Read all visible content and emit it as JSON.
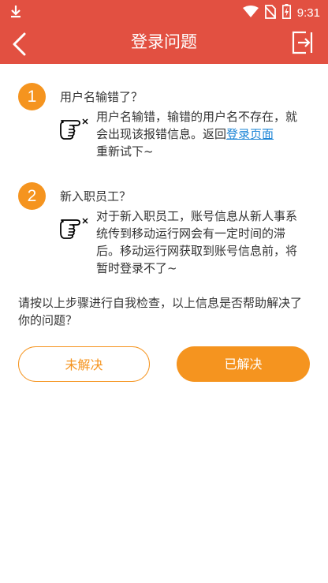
{
  "status_bar": {
    "time": "9:31"
  },
  "app_bar": {
    "title": "登录问题"
  },
  "questions": [
    {
      "number": "1",
      "title": "用户名输错了？",
      "answer_text": "用户名输错，输错的用户名不存在，就会出现该报错信息。返回",
      "answer_link": "登录页面",
      "answer_tail": "重新试下~"
    },
    {
      "number": "2",
      "title": "新入职员工？",
      "answer_text": "对于新入职员工，账号信息从新人事系统传到移动运行网会有一定时间的滞后。移动运行网获取到账号信息前，将暂时登录不了~"
    }
  ],
  "prompt": "请按以上步骤进行自我检查，以上信息是否帮助解决了你的问题？",
  "buttons": {
    "unsolved": "未解决",
    "solved": "已解决"
  },
  "colors": {
    "header": "#e25041",
    "accent": "#f5941f",
    "link": "#1a84d6"
  }
}
